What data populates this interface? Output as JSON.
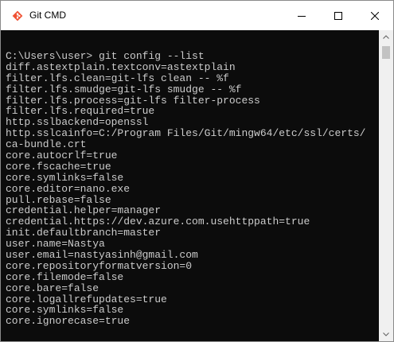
{
  "window": {
    "title": "Git CMD",
    "app_icon": "git-diamond-icon",
    "controls": {
      "minimize_icon": "minimize-icon",
      "maximize_icon": "maximize-icon",
      "close_icon": "close-icon"
    },
    "accent_color": "#f05133"
  },
  "console": {
    "background": "#0c0c0c",
    "text_color": "#cccccc",
    "lines": [
      "C:\\Users\\user> git config --list",
      "diff.astextplain.textconv=astextplain",
      "filter.lfs.clean=git-lfs clean -- %f",
      "filter.lfs.smudge=git-lfs smudge -- %f",
      "filter.lfs.process=git-lfs filter-process",
      "filter.lfs.required=true",
      "http.sslbackend=openssl",
      "http.sslcainfo=C:/Program Files/Git/mingw64/etc/ssl/certs/",
      "ca-bundle.crt",
      "core.autocrlf=true",
      "core.fscache=true",
      "core.symlinks=false",
      "core.editor=nano.exe",
      "pull.rebase=false",
      "credential.helper=manager",
      "credential.https://dev.azure.com.usehttppath=true",
      "init.defaultbranch=master",
      "user.name=Nastya",
      "user.email=nastyasinh@gmail.com",
      "core.repositoryformatversion=0",
      "core.filemode=false",
      "core.bare=false",
      "core.logallrefupdates=true",
      "core.symlinks=false",
      "core.ignorecase=true"
    ]
  },
  "scrollbar": {
    "up_icon": "scroll-up-arrow-icon",
    "down_icon": "scroll-down-arrow-icon"
  }
}
